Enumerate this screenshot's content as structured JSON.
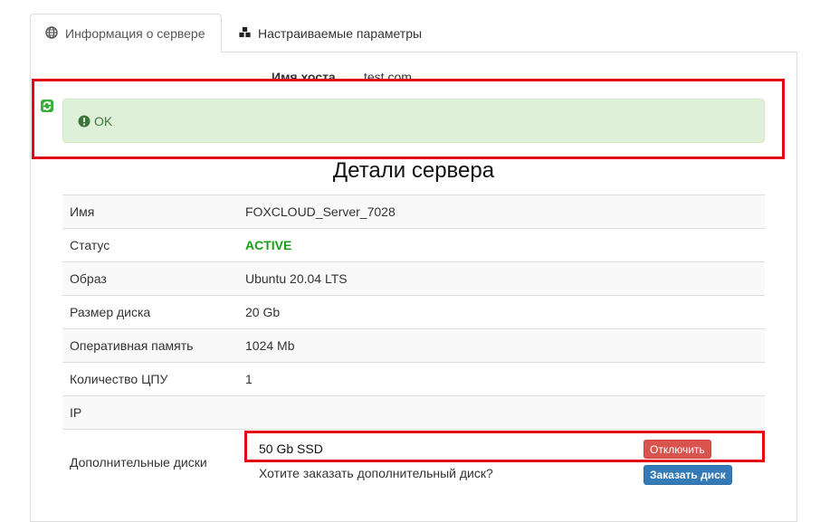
{
  "tabs": [
    {
      "label": "Информация о сервере",
      "icon": "globe-icon",
      "active": true
    },
    {
      "label": "Настраиваемые параметры",
      "icon": "cubes-icon",
      "active": false
    }
  ],
  "host": {
    "label": "Имя хоста",
    "value": "test.com"
  },
  "alert": {
    "text": "OK",
    "icon": "exclamation-circle-icon",
    "refresh_icon": "refresh-icon"
  },
  "heading": "Детали сервера",
  "details": [
    {
      "label": "Имя",
      "value": "FOXCLOUD_Server_7028"
    },
    {
      "label": "Статус",
      "value": "ACTIVE"
    },
    {
      "label": "Образ",
      "value": "Ubuntu 20.04 LTS"
    },
    {
      "label": "Размер диска",
      "value": "20 Gb"
    },
    {
      "label": "Оперативная память",
      "value": "1024 Mb"
    },
    {
      "label": "Количество ЦПУ",
      "value": "1"
    },
    {
      "label": "IP",
      "value": ""
    }
  ],
  "extra_disks": {
    "label": "Дополнительные диски",
    "disk_name": "50 Gb SSD",
    "disconnect_label": "Отключить",
    "order_question": "Хотите заказать дополнительный диск?",
    "order_label": "Заказать диск"
  },
  "colors": {
    "alert_bg": "#dff0d8",
    "alert_text": "#3c763d",
    "status_active": "#16a016",
    "danger": "#d9534f",
    "primary": "#337ab7",
    "highlight": "#e40613"
  }
}
